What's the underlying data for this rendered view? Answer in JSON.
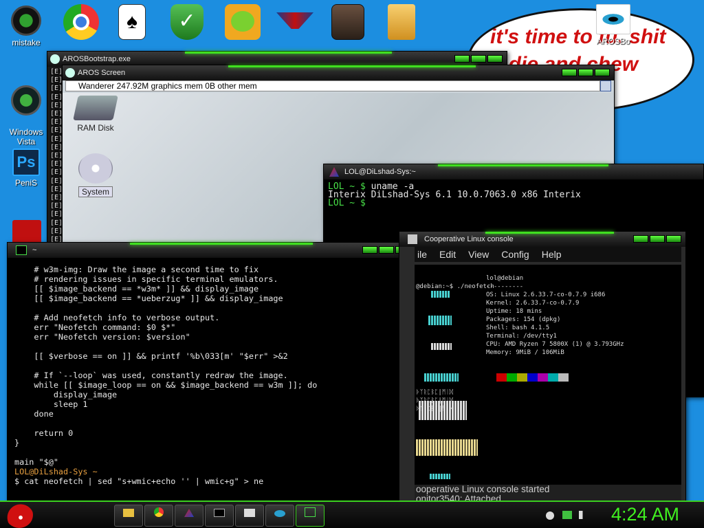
{
  "desktop_icons": [
    {
      "label": "mistake"
    },
    {
      "label": "Windows\nVista"
    },
    {
      "label": "PeniS"
    }
  ],
  "top_icons": [
    "chrome-icon",
    "solitaire-icon",
    "shield-check-icon",
    "angry-birds-pig-icon",
    "gamer-logo-icon",
    "media-player-icon",
    "folder-icon"
  ],
  "bubble": {
    "line1": "it's time to fu. shit",
    "line2": "d die and chew",
    "corner_label": "AROSBo"
  },
  "bootstrap": {
    "title": "AROSBootstrap.exe",
    "line_marker": "[E]"
  },
  "aros": {
    "title": "AROS Screen",
    "bar_text": "Wanderer 247.92M graphics mem 0B other mem",
    "icons": [
      {
        "label": "RAM Disk"
      },
      {
        "label": "System"
      }
    ]
  },
  "interix": {
    "title": "LOL@DiLshad-Sys:~",
    "lines": [
      {
        "prompt": "LOL ~ $ ",
        "text": "uname -a"
      },
      {
        "prompt": "",
        "text": "Interix DiLshad-Sys 6.1 10.0.7063.0 x86 Interix"
      },
      {
        "prompt": "LOL ~ $ ",
        "text": ""
      }
    ]
  },
  "bash": {
    "title": "~",
    "code": "    # w3m-img: Draw the image a second time to fix\n    # rendering issues in specific terminal emulators.\n    [[ $image_backend == *w3m* ]] && display_image\n    [[ $image_backend == *ueberzug* ]] && display_image\n\n    # Add neofetch info to verbose output.\n    err \"Neofetch command: $0 $*\"\n    err \"Neofetch version: $version\"\n\n    [[ $verbose == on ]] && printf '%b\\033[m' \"$err\" >&2\n\n    # If `--loop` was used, constantly redraw the image.\n    while [[ $image_loop == on && $image_backend == w3m ]]; do\n        display_image\n        sleep 1\n    done\n\n    return 0\n}\n\nmain \"$@\"\n",
    "prompt": "LOL@DiLshad-Sys ~",
    "command": "$ cat neofetch | sed \"s+wmic+echo '' | wmic+g\" > ne"
  },
  "colinux": {
    "title": "Cooperative Linux console",
    "menu": [
      "ile",
      "Edit",
      "View",
      "Config",
      "Help"
    ],
    "cmd": "@debian:~$ ./neofetch",
    "info": [
      "lol@debian",
      "----------",
      "OS: Linux 2.6.33.7-co-0.7.9 i686",
      "Kernel: 2.6.33.7-co-0.7.9",
      "Uptime: 18 mins",
      "Packages: 154 (dpkg)",
      "Shell: bash 4.1.5",
      "Terminal: /dev/tty1",
      "CPU: AMD Ryzen 7 5800X (1) @ 3.793GHz",
      "Memory: 9MiB / 106MiB"
    ],
    "swatches": [
      "#000000",
      "#cc0000",
      "#00aa00",
      "#aaaa00",
      "#0000cc",
      "#aa00aa",
      "#00aaaa",
      "#bbbbbb"
    ],
    "garbage": [
      "ᚦᛉᚱᛈᛒᛈ|ᛗᛁᛞ",
      "ᚦᛉᚱᛈᛒᛈ|ᛗᛁᛞ",
      "ᚦᛉᚱᛈᛒᛈ|ᛗᛁᛞᚲ"
    ],
    "status1": "ooperative Linux console started",
    "status2": "onitor3540: Attached"
  },
  "taskbar": {
    "clock": "4:24 AM",
    "buttons": [
      "folder-icon",
      "chrome-icon",
      "aros-icon",
      "cmd-icon",
      "window-icon",
      "aros-eye-icon",
      "terminal-icon"
    ]
  }
}
